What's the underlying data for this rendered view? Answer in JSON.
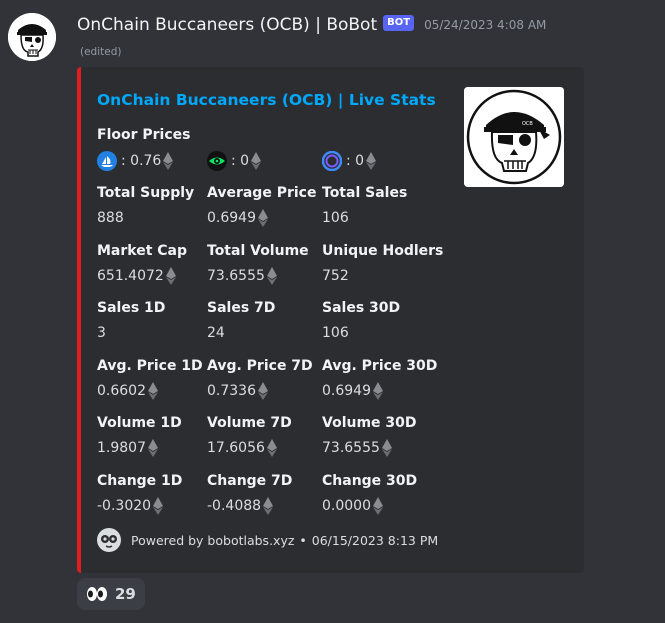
{
  "author": {
    "name": "OnChain Buccaneers (OCB) | BoBot",
    "badge": "BOT",
    "timestamp": "05/24/2023 4:08 AM",
    "edited": "(edited)"
  },
  "embed": {
    "title": "OnChain Buccaneers (OCB) | Live Stats",
    "accent_color": "#e01e1e",
    "floor_prices": {
      "label": "Floor Prices",
      "items": [
        {
          "marketplace_icon": "opensea-icon",
          "value": ": 0.76"
        },
        {
          "marketplace_icon": "looksrare-icon",
          "value": ": 0"
        },
        {
          "marketplace_icon": "x2y2-icon",
          "value": ": 0"
        }
      ]
    },
    "fields": [
      [
        {
          "name": "Total Supply",
          "value": "888",
          "eth": false
        },
        {
          "name": "Average Price",
          "value": "0.6949",
          "eth": true
        },
        {
          "name": "Total Sales",
          "value": "106",
          "eth": false
        }
      ],
      [
        {
          "name": "Market Cap",
          "value": "651.4072",
          "eth": true
        },
        {
          "name": "Total Volume",
          "value": "73.6555",
          "eth": true
        },
        {
          "name": "Unique Hodlers",
          "value": "752",
          "eth": false
        }
      ],
      [
        {
          "name": "Sales 1D",
          "value": "3",
          "eth": false
        },
        {
          "name": "Sales 7D",
          "value": "24",
          "eth": false
        },
        {
          "name": "Sales 30D",
          "value": "106",
          "eth": false
        }
      ],
      [
        {
          "name": "Avg. Price 1D",
          "value": "0.6602",
          "eth": true
        },
        {
          "name": "Avg. Price 7D",
          "value": "0.7336",
          "eth": true
        },
        {
          "name": "Avg. Price 30D",
          "value": "0.6949",
          "eth": true
        }
      ],
      [
        {
          "name": "Volume 1D",
          "value": "1.9807",
          "eth": true
        },
        {
          "name": "Volume 7D",
          "value": "17.6056",
          "eth": true
        },
        {
          "name": "Volume 30D",
          "value": "73.6555",
          "eth": true
        }
      ],
      [
        {
          "name": "Change 1D",
          "value": "-0.3020",
          "eth": true
        },
        {
          "name": "Change 7D",
          "value": "-0.4088",
          "eth": true
        },
        {
          "name": "Change 30D",
          "value": "0.0000",
          "eth": true
        }
      ]
    ],
    "footer": {
      "text": "Powered by bobotlabs.xyz",
      "separator": "•",
      "timestamp": "06/15/2023 8:13 PM"
    }
  },
  "reaction": {
    "emoji_icon": "eyes-icon",
    "count": "29"
  },
  "colors": {
    "background": "#313338",
    "embed_background": "#2b2d31",
    "link": "#00a8fc",
    "bot_badge": "#5865f2"
  }
}
